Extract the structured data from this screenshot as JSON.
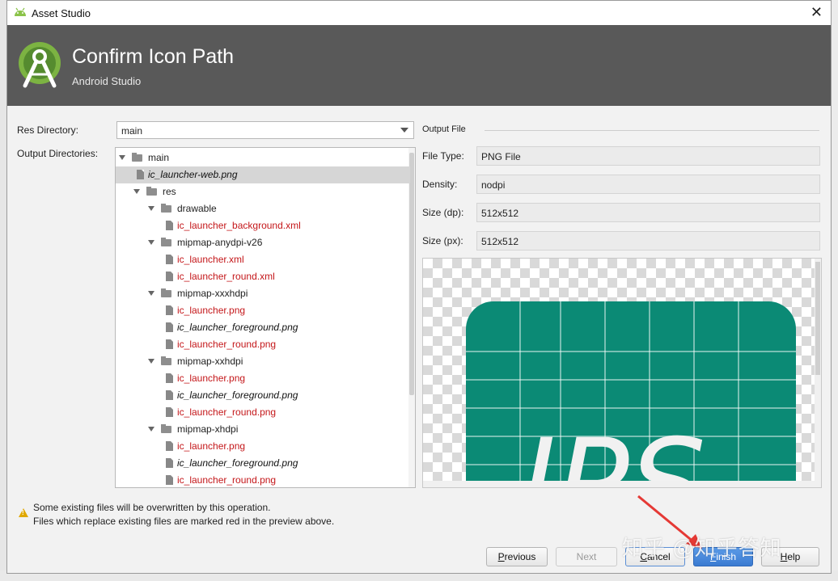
{
  "window": {
    "title": "Asset Studio"
  },
  "header": {
    "title": "Confirm Icon Path",
    "subtitle": "Android Studio"
  },
  "form": {
    "res_directory_label": "Res Directory:",
    "res_directory_value": "main",
    "output_dirs_label": "Output Directories:"
  },
  "tree": {
    "rows": [
      {
        "name": "main",
        "type": "folder"
      },
      {
        "name": "ic_launcher-web.png",
        "type": "file",
        "style": "italic",
        "selected": true
      },
      {
        "name": "res",
        "type": "folder"
      },
      {
        "name": "drawable",
        "type": "folder"
      },
      {
        "name": "ic_launcher_background.xml",
        "type": "file",
        "style": "red"
      },
      {
        "name": "mipmap-anydpi-v26",
        "type": "folder"
      },
      {
        "name": "ic_launcher.xml",
        "type": "file",
        "style": "red"
      },
      {
        "name": "ic_launcher_round.xml",
        "type": "file",
        "style": "red"
      },
      {
        "name": "mipmap-xxxhdpi",
        "type": "folder"
      },
      {
        "name": "ic_launcher.png",
        "type": "file",
        "style": "red"
      },
      {
        "name": "ic_launcher_foreground.png",
        "type": "file",
        "style": "italic"
      },
      {
        "name": "ic_launcher_round.png",
        "type": "file",
        "style": "red"
      },
      {
        "name": "mipmap-xxhdpi",
        "type": "folder"
      },
      {
        "name": "ic_launcher.png",
        "type": "file",
        "style": "red"
      },
      {
        "name": "ic_launcher_foreground.png",
        "type": "file",
        "style": "italic"
      },
      {
        "name": "ic_launcher_round.png",
        "type": "file",
        "style": "red"
      },
      {
        "name": "mipmap-xhdpi",
        "type": "folder"
      },
      {
        "name": "ic_launcher.png",
        "type": "file",
        "style": "red"
      },
      {
        "name": "ic_launcher_foreground.png",
        "type": "file",
        "style": "italic"
      },
      {
        "name": "ic_launcher_round.png",
        "type": "file",
        "style": "red"
      }
    ]
  },
  "output_file": {
    "section_label": "Output File",
    "file_type_label": "File Type:",
    "file_type_value": "PNG File",
    "density_label": "Density:",
    "density_value": "nodpi",
    "size_dp_label": "Size (dp):",
    "size_dp_value": "512x512",
    "size_px_label": "Size (px):",
    "size_px_value": "512x512"
  },
  "preview": {
    "icon_text": "IPS",
    "icon_color": "#0b8a75"
  },
  "warning": {
    "line1": "Some existing files will be overwritten by this operation.",
    "line2": "Files which replace existing files are marked red in the preview above."
  },
  "buttons": {
    "previous_prefix": "",
    "previous_mnemonic": "P",
    "previous_rest": "revious",
    "next": "Next",
    "cancel_mnemonic": "C",
    "cancel_rest": "ancel",
    "finish_mnemonic": "F",
    "finish_rest": "inish",
    "help_mnemonic": "H",
    "help_rest": "elp"
  },
  "watermark": "知乎 @知乎答知",
  "colors": {
    "header_bg": "#595959",
    "replaced_file": "#c4171a",
    "accent": "#3b7bd1"
  }
}
